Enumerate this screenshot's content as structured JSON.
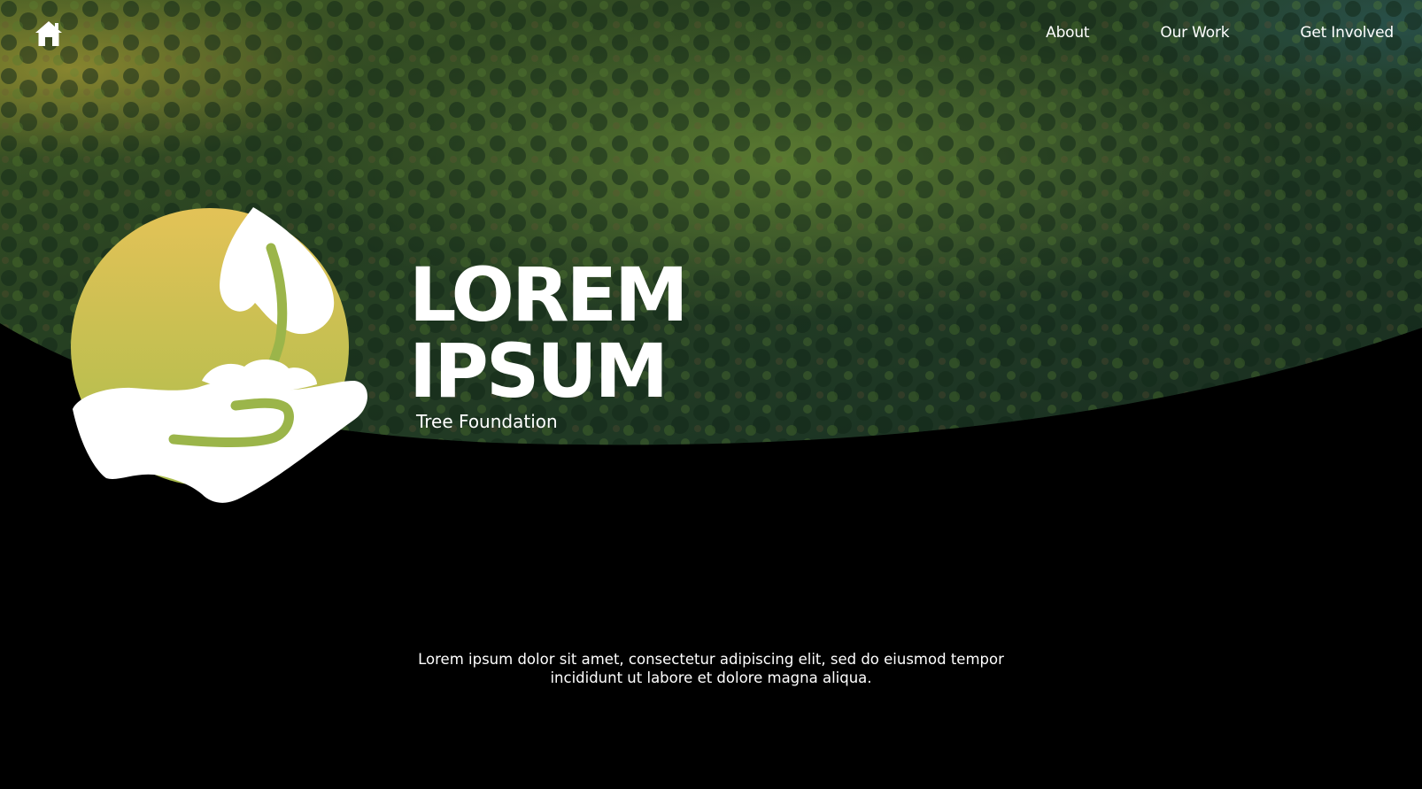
{
  "nav": {
    "home_icon": "home-icon",
    "items": [
      {
        "label": "About"
      },
      {
        "label": "Our Work"
      },
      {
        "label": "Get Involved"
      }
    ]
  },
  "hero": {
    "title_line1": "LOREM",
    "title_line2": "IPSUM",
    "subtitle": "Tree Foundation",
    "background": "aerial forest photo",
    "logo_icon": "hand-holding-sprout-icon"
  },
  "intro": {
    "line1": "Lorem ipsum dolor sit amet, consectetur adipiscing elit, sed do eiusmod tempor",
    "line2": "incididunt ut labore et dolore magna aliqua."
  },
  "colors": {
    "logo_gradient_top": "#e3c257",
    "logo_gradient_bottom": "#a9bd4c",
    "stem_green": "#9bb54a",
    "background": "#000000",
    "forest_dark": "#1f3a24",
    "forest_light": "#6f9a3a"
  }
}
